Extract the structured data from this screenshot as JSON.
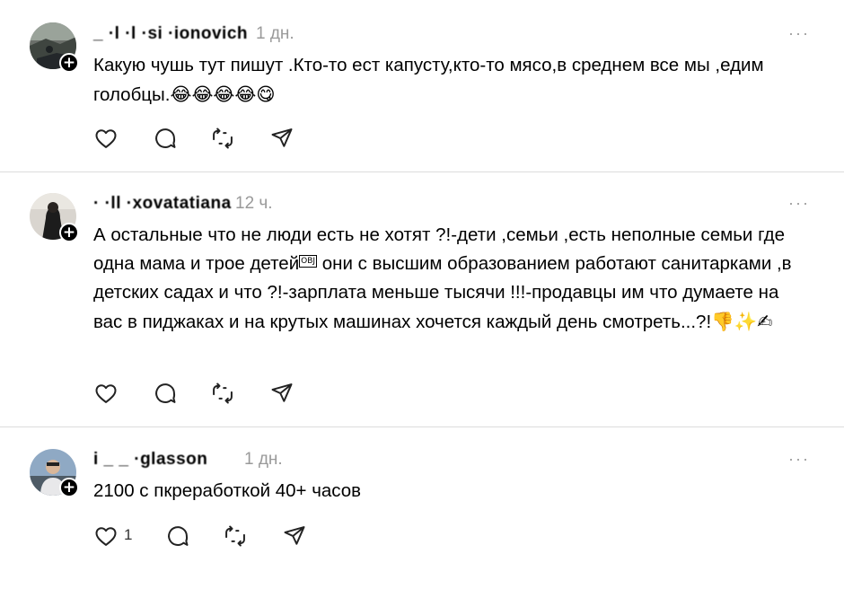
{
  "posts": [
    {
      "username": "_ ·l ·l ·si ·ionovich",
      "time": "1 дн.",
      "more": "···",
      "text": "Какую чушь тут пишут .Кто-то ест капусту,кто-то мясо,в среднем все мы ,едим голобцы.",
      "emoji": "😂😂😂😂😋",
      "like_count": ""
    },
    {
      "username": "· ·ll ·xovatatiana",
      "time": "12 ч.",
      "more": "···",
      "text_part1": "А остальные что не люди есть не хотят ?!-дети ,семьи ,есть неполные семьи где одна мама и трое детей",
      "obj": "OBJ",
      "text_part2": " они с высшим образованием работают санитарками ,в детских садах и что ?!-зарплата меньше тысячи !!!-продавцы им что думаете на вас в пиджаках и на крутых машинах хочется каждый день смотреть...?!",
      "emoji": "👎✨✍",
      "like_count": ""
    },
    {
      "username": "i _ _ ·glasson",
      "time": "1 дн.",
      "more": "···",
      "text": "2100 с пкреработкой 40+ часов",
      "like_count": "1"
    }
  ],
  "icons": {
    "like": "heart-icon",
    "reply": "comment-icon",
    "repost": "repost-icon",
    "share": "send-icon",
    "follow": "plus-icon",
    "more": "more-icon"
  }
}
